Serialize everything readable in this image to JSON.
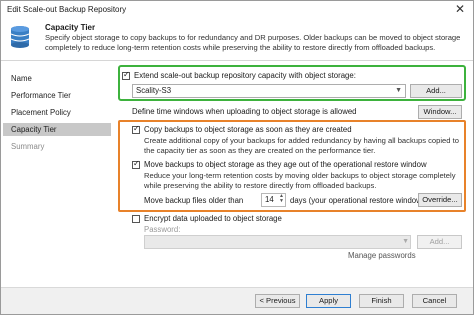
{
  "window": {
    "title": "Edit Scale-out Backup Repository",
    "close_glyph": "✕"
  },
  "header": {
    "title": "Capacity Tier",
    "description": "Specify object storage to copy backups to for redundancy and DR purposes. Older backups can be moved to object storage completely to reduce long-term retention costs while preserving the ability to restore directly from offloaded backups.",
    "icon": "database-icon"
  },
  "sidebar": {
    "items": [
      {
        "label": "Name",
        "state": "normal"
      },
      {
        "label": "Performance Tier",
        "state": "normal"
      },
      {
        "label": "Placement Policy",
        "state": "normal"
      },
      {
        "label": "Capacity Tier",
        "state": "active"
      },
      {
        "label": "Summary",
        "state": "disabled"
      }
    ]
  },
  "extend": {
    "checked": true,
    "label": "Extend scale-out backup repository capacity with object storage:",
    "storage_value": "Scality-S3",
    "add_label": "Add..."
  },
  "time_window": {
    "label": "Define time windows when uploading to object storage is allowed",
    "button_label": "Window..."
  },
  "copy": {
    "checked": true,
    "label": "Copy backups to object storage as soon as they are created",
    "description": "Create additional copy of your backups for added redundancy by having all backups copied to the capacity tier as soon as they are created on the performance tier."
  },
  "move": {
    "checked": true,
    "label": "Move backups to object storage as they age out of the operational restore window",
    "description": "Reduce your long-term retention costs by moving older backups to object storage completely while preserving the ability to restore directly from offloaded backups.",
    "days_prefix": "Move backup files older than",
    "days_value": "14",
    "days_suffix": "days (your operational restore window)",
    "override_label": "Override..."
  },
  "encrypt": {
    "checked": false,
    "label": "Encrypt data uploaded to object storage",
    "password_label": "Password:",
    "add_label": "Add...",
    "manage_label": "Manage passwords"
  },
  "footer": {
    "previous": "< Previous",
    "apply": "Apply",
    "finish": "Finish",
    "cancel": "Cancel"
  },
  "colors": {
    "highlight_green": "#3db23d",
    "highlight_orange": "#e8822a",
    "active_nav": "#c8c8c8"
  }
}
